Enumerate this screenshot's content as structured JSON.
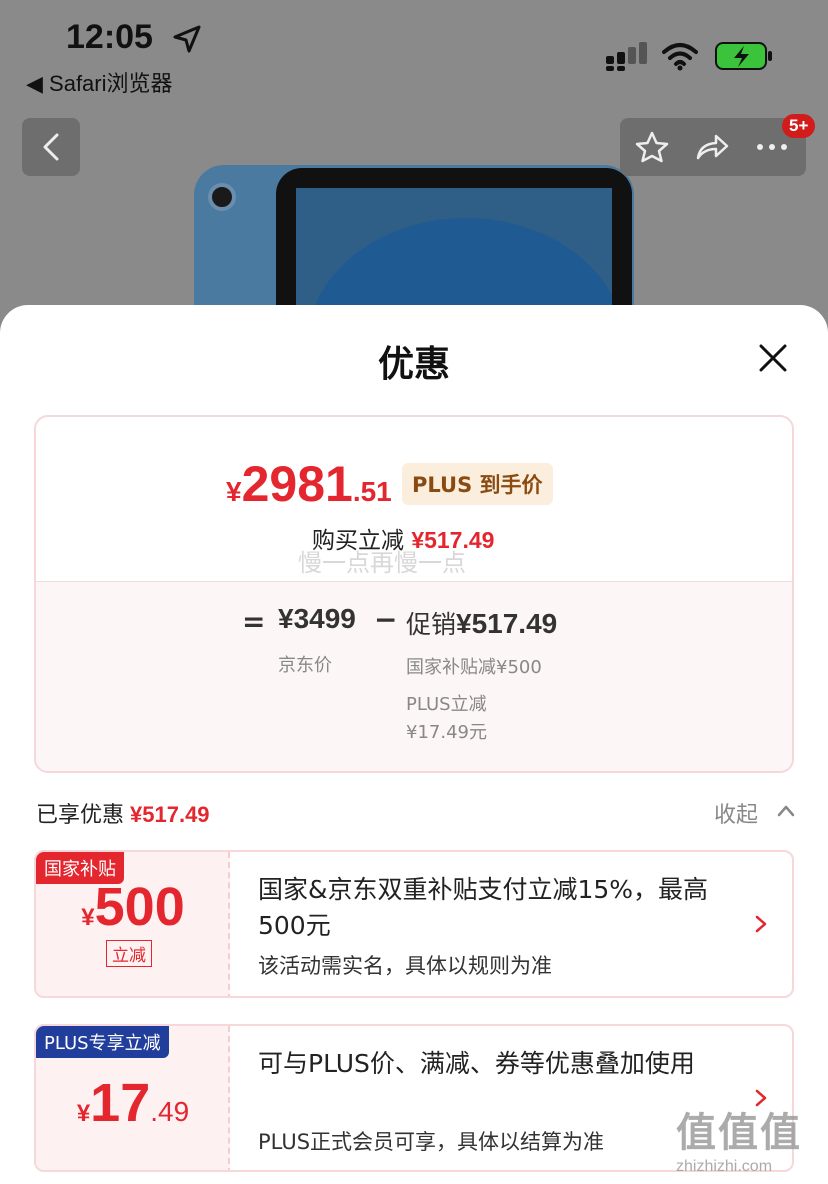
{
  "status_bar": {
    "time": "12:05",
    "back_app_label": "◀ Safari浏览器"
  },
  "nav": {
    "badge": "5+"
  },
  "sheet": {
    "title": "优惠"
  },
  "price_card": {
    "final_yen": "¥",
    "final_int": "2981",
    "final_dec": ".51",
    "plus_tag": "PLUS 到手价",
    "reduce_label": "购买立减",
    "reduce_amount": "¥517.49",
    "watermark": "慢一点再慢一点",
    "equals": "=",
    "jd_price": "¥3499",
    "jd_label": "京东价",
    "minus": "−",
    "promo_label": "促销",
    "promo_amount": "¥517.49",
    "promo_detail_1": "国家补贴减¥500",
    "promo_detail_2_line1": "PLUS立减",
    "promo_detail_2_line2": "¥17.49元"
  },
  "enjoyed": {
    "label": "已享优惠",
    "amount": "¥517.49",
    "collapse_label": "收起"
  },
  "coupons": [
    {
      "tag": "国家补贴",
      "yen": "¥",
      "amount_big": "500",
      "amount_small": "",
      "stamp": "立减",
      "desc": "国家&京东双重补贴支付立减15%，最高500元",
      "sub": "该活动需实名，具体以规则为准"
    },
    {
      "tag": "PLUS专享立减",
      "yen": "¥",
      "amount_big": "17",
      "amount_small": ".49",
      "stamp": "",
      "desc": "可与PLUS价、满减、券等优惠叠加使用",
      "sub": "PLUS正式会员可享，具体以结算为准"
    }
  ],
  "watermark_site": {
    "text": "值值值",
    "url": "zhizhizhi.com"
  },
  "colors": {
    "accent_red": "#e4262e",
    "plus_blue": "#223e9c",
    "plus_tag_bg": "#fbeedd"
  }
}
